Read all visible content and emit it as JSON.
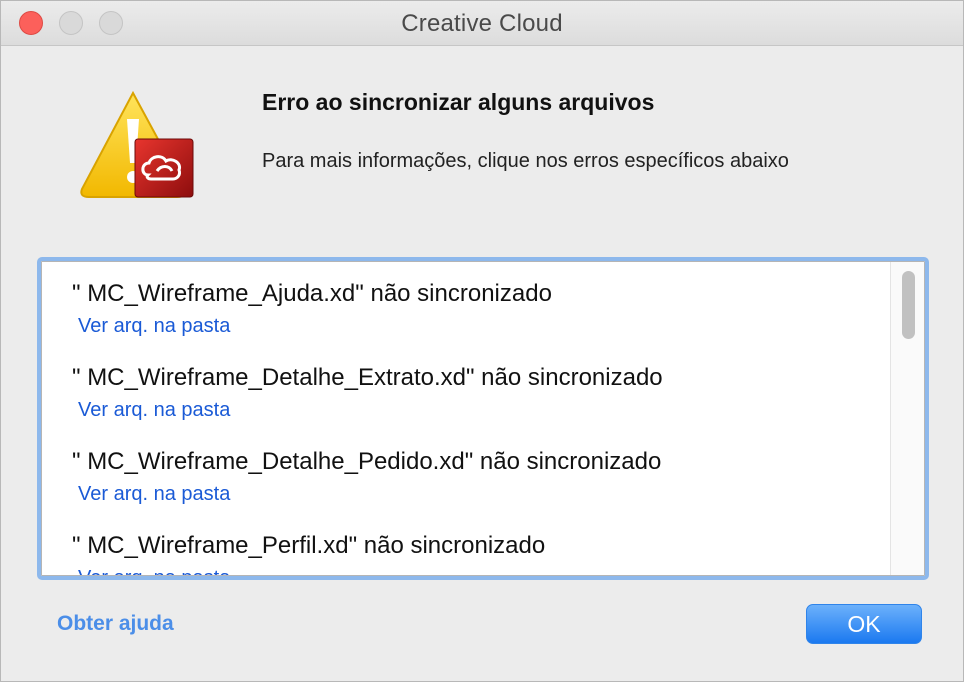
{
  "window": {
    "title": "Creative Cloud"
  },
  "dialog": {
    "heading": "Erro ao sincronizar alguns arquivos",
    "subtext": "Para mais informações, clique nos erros específicos abaixo",
    "icon": "warning-creative-cloud-icon"
  },
  "errors": [
    {
      "file": "\" MC_Wireframe_Ajuda.xd\" não sincronizado",
      "link": "Ver arq. na pasta"
    },
    {
      "file": "\" MC_Wireframe_Detalhe_Extrato.xd\" não sincronizado",
      "link": "Ver arq. na pasta"
    },
    {
      "file": "\" MC_Wireframe_Detalhe_Pedido.xd\" não sincronizado",
      "link": "Ver arq. na pasta"
    },
    {
      "file": "\" MC_Wireframe_Perfil.xd\" não sincronizado",
      "link": "Ver arq. na pasta"
    }
  ],
  "footer": {
    "help_label": "Obter ajuda",
    "ok_label": "OK"
  },
  "colors": {
    "accent": "#1b79f0",
    "link": "#1a5ad6",
    "help_link": "#4b8ee8",
    "warning": "#f7c600",
    "brand": "#c01a1a"
  }
}
